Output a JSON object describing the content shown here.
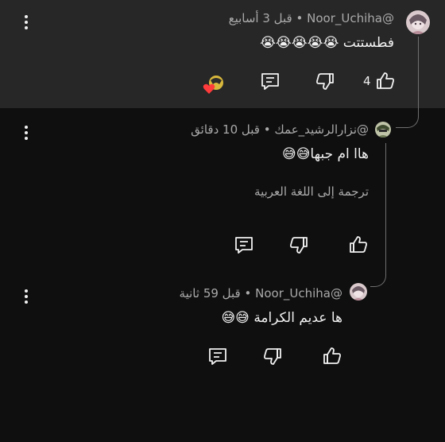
{
  "comments": [
    {
      "author": "@Noor_Uchiha",
      "time": "قبل 3 أسابيع",
      "separator": "•",
      "text": "فطستتت",
      "emoji": "😭😭😭😭😭",
      "like_count": "4",
      "avatar_icon": "anime-avatar",
      "creator_heart_icon": "creator-heart-badge"
    },
    {
      "author": "@نزارالرشيد_عمك",
      "time": "قبل 10 دقائق",
      "separator": "•",
      "text": "هاا ام جبها",
      "emoji": "😅😅",
      "translate_label": "ترجمة إلى اللغة العربية",
      "avatar_icon": "anime-avatar"
    },
    {
      "author": "@Noor_Uchiha",
      "time": "قبل 59 ثانية",
      "separator": "•",
      "text": "ها عديم الكرامة",
      "emoji": "😅😅",
      "avatar_icon": "anime-avatar"
    }
  ],
  "colors": {
    "background": "#0f0f0f",
    "highlight": "#272727",
    "text": "#f1f1f1",
    "secondary_text": "#aaaaaa",
    "thread_line": "#6f6f6f"
  },
  "icons": [
    "more-vert-icon",
    "like-icon",
    "dislike-icon",
    "reply-icon",
    "creator-heart-icon"
  ]
}
